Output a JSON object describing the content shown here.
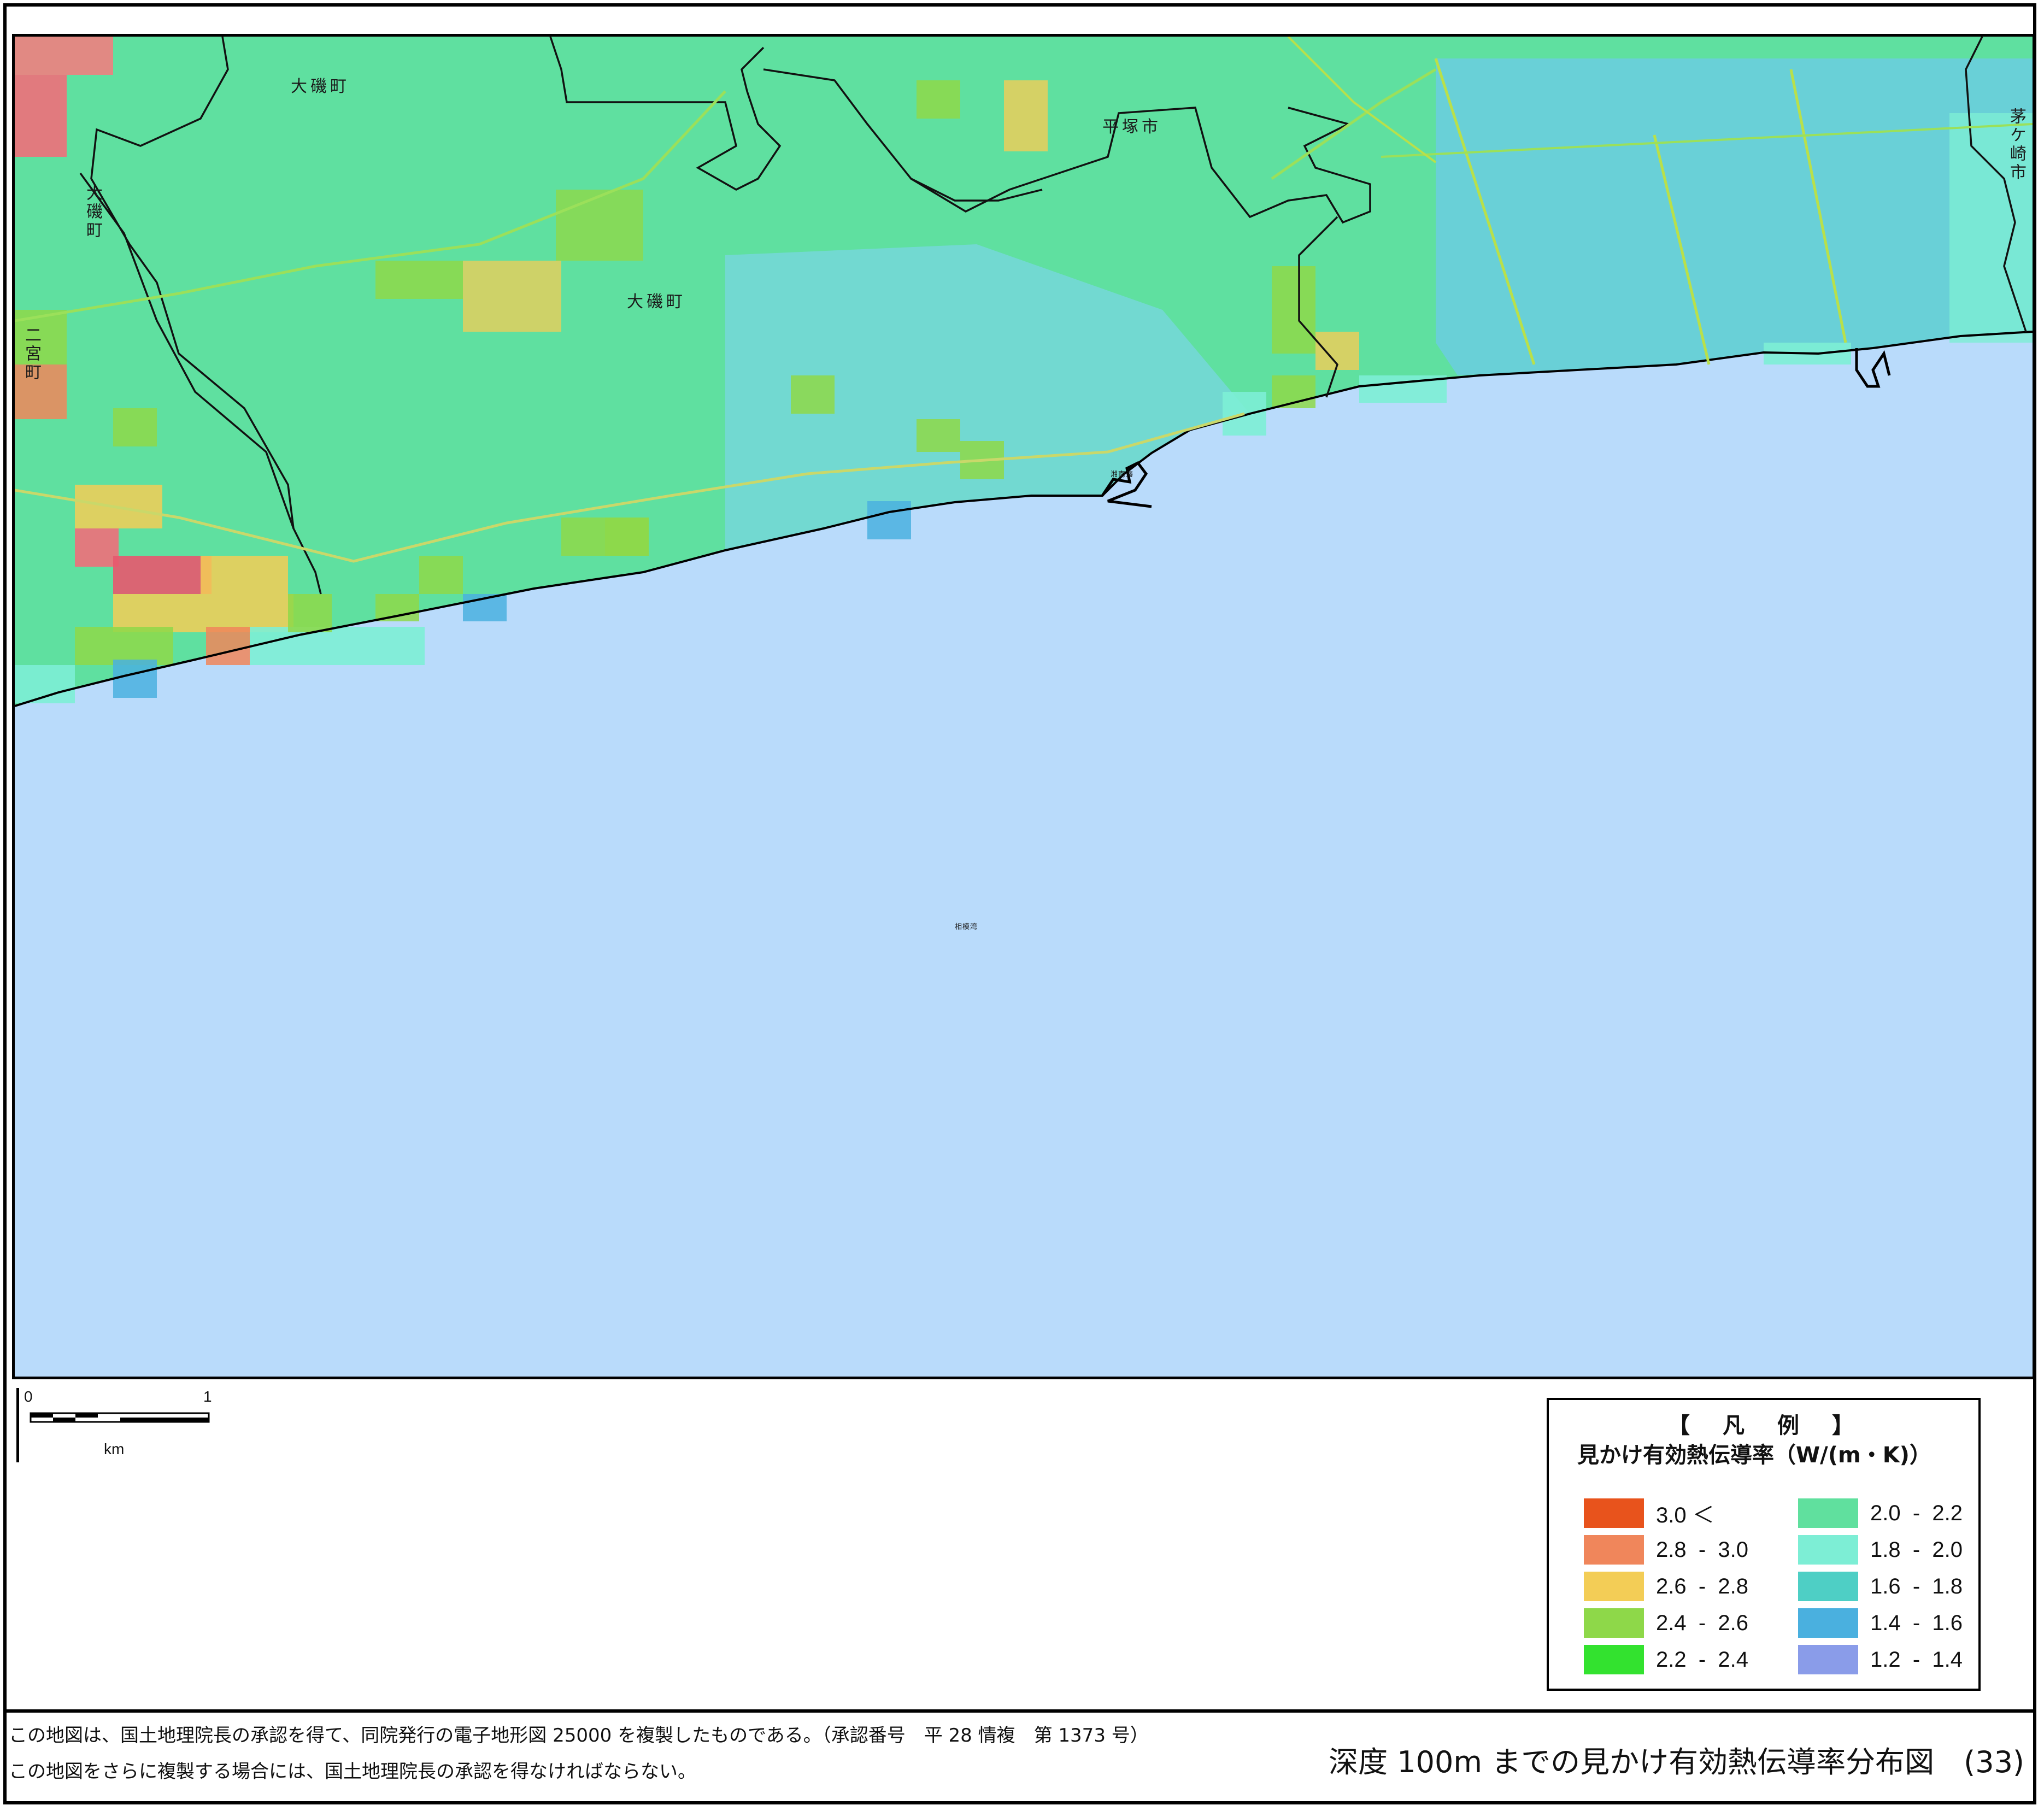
{
  "map": {
    "place_labels": [
      {
        "text": "大磯町"
      },
      {
        "text": "大磯町"
      },
      {
        "text": "平塚市"
      },
      {
        "text": "大磯町"
      },
      {
        "text": "二宮町"
      },
      {
        "text": "茅ケ崎市"
      },
      {
        "text": "湘南海"
      }
    ],
    "sea_label": "相模湾",
    "sea_color": "#b9dbfb",
    "land_color": "#58e2a0"
  },
  "scale": {
    "tick_0": "0",
    "tick_1": "1",
    "unit": "km"
  },
  "legend": {
    "title": "【　凡　例　】",
    "subtitle": "見かけ有効熱伝導率（W/(m・K)）",
    "items": [
      {
        "label": "3.0 ＜",
        "color": "#e8531c"
      },
      {
        "label": "2.8  -  3.0",
        "color": "#f0865b"
      },
      {
        "label": "2.6  -  2.8",
        "color": "#f3cd56"
      },
      {
        "label": "2.4  -  2.6",
        "color": "#8ed849"
      },
      {
        "label": "2.2  -  2.4",
        "color": "#33e22f"
      },
      {
        "label": "2.0  -  2.2",
        "color": "#60e09e"
      },
      {
        "label": "1.8  -  2.0",
        "color": "#7deed5"
      },
      {
        "label": "1.6  -  1.8",
        "color": "#4ecfc5"
      },
      {
        "label": "1.4  -  1.6",
        "color": "#4ab0df"
      },
      {
        "label": "1.2  -  1.4",
        "color": "#8a9ce9"
      }
    ]
  },
  "footer": {
    "note1": "この地図は、国土地理院長の承認を得て、同院発行の電子地形図 25000 を複製したものである。（承認番号　平 28 情複　第 1373 号）",
    "note2": "この地図をさらに複製する場合には、国土地理院長の承認を得なければならない。",
    "title": "深度 100m までの見かけ有効熱伝導率分布図　(33)"
  }
}
